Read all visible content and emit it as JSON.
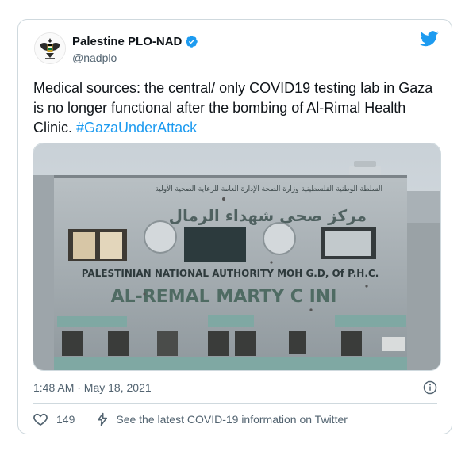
{
  "tweet": {
    "author_name": "Palestine PLO-NAD",
    "handle": "@nadplo",
    "text_main": "Medical sources: the central/ only COVID19 testing lab in Gaza is no longer functional after the bombing of Al-Rimal Health Clinic. ",
    "hashtag": "#GazaUnderAttack",
    "timestamp": "1:48 AM · May 18, 2021",
    "like_count": "149",
    "covid_link": "See the latest COVID-19 information on Twitter"
  },
  "photo_signage": {
    "english_line1": "PALESTINIAN NATIONAL AUTHORITY MOH G.D, Of P.H.C.",
    "english_line2": "AL-REMAL MARTY   C INI",
    "arabic_line1": "السلطة الوطنية الفلسطينية     وزارة الصحة     الإدارة العامة للرعاية الصحية الأولية",
    "arabic_line2": "مركز صحي شهداء الرمال"
  },
  "icons": {
    "logo": "twitter-bird-icon",
    "verified": "verified-badge-icon",
    "info": "info-icon",
    "like": "heart-icon",
    "covid": "lightning-icon"
  },
  "colors": {
    "accent": "#1d9bf0",
    "text": "#0f1419",
    "muted": "#536471",
    "border": "#cfd9de"
  }
}
